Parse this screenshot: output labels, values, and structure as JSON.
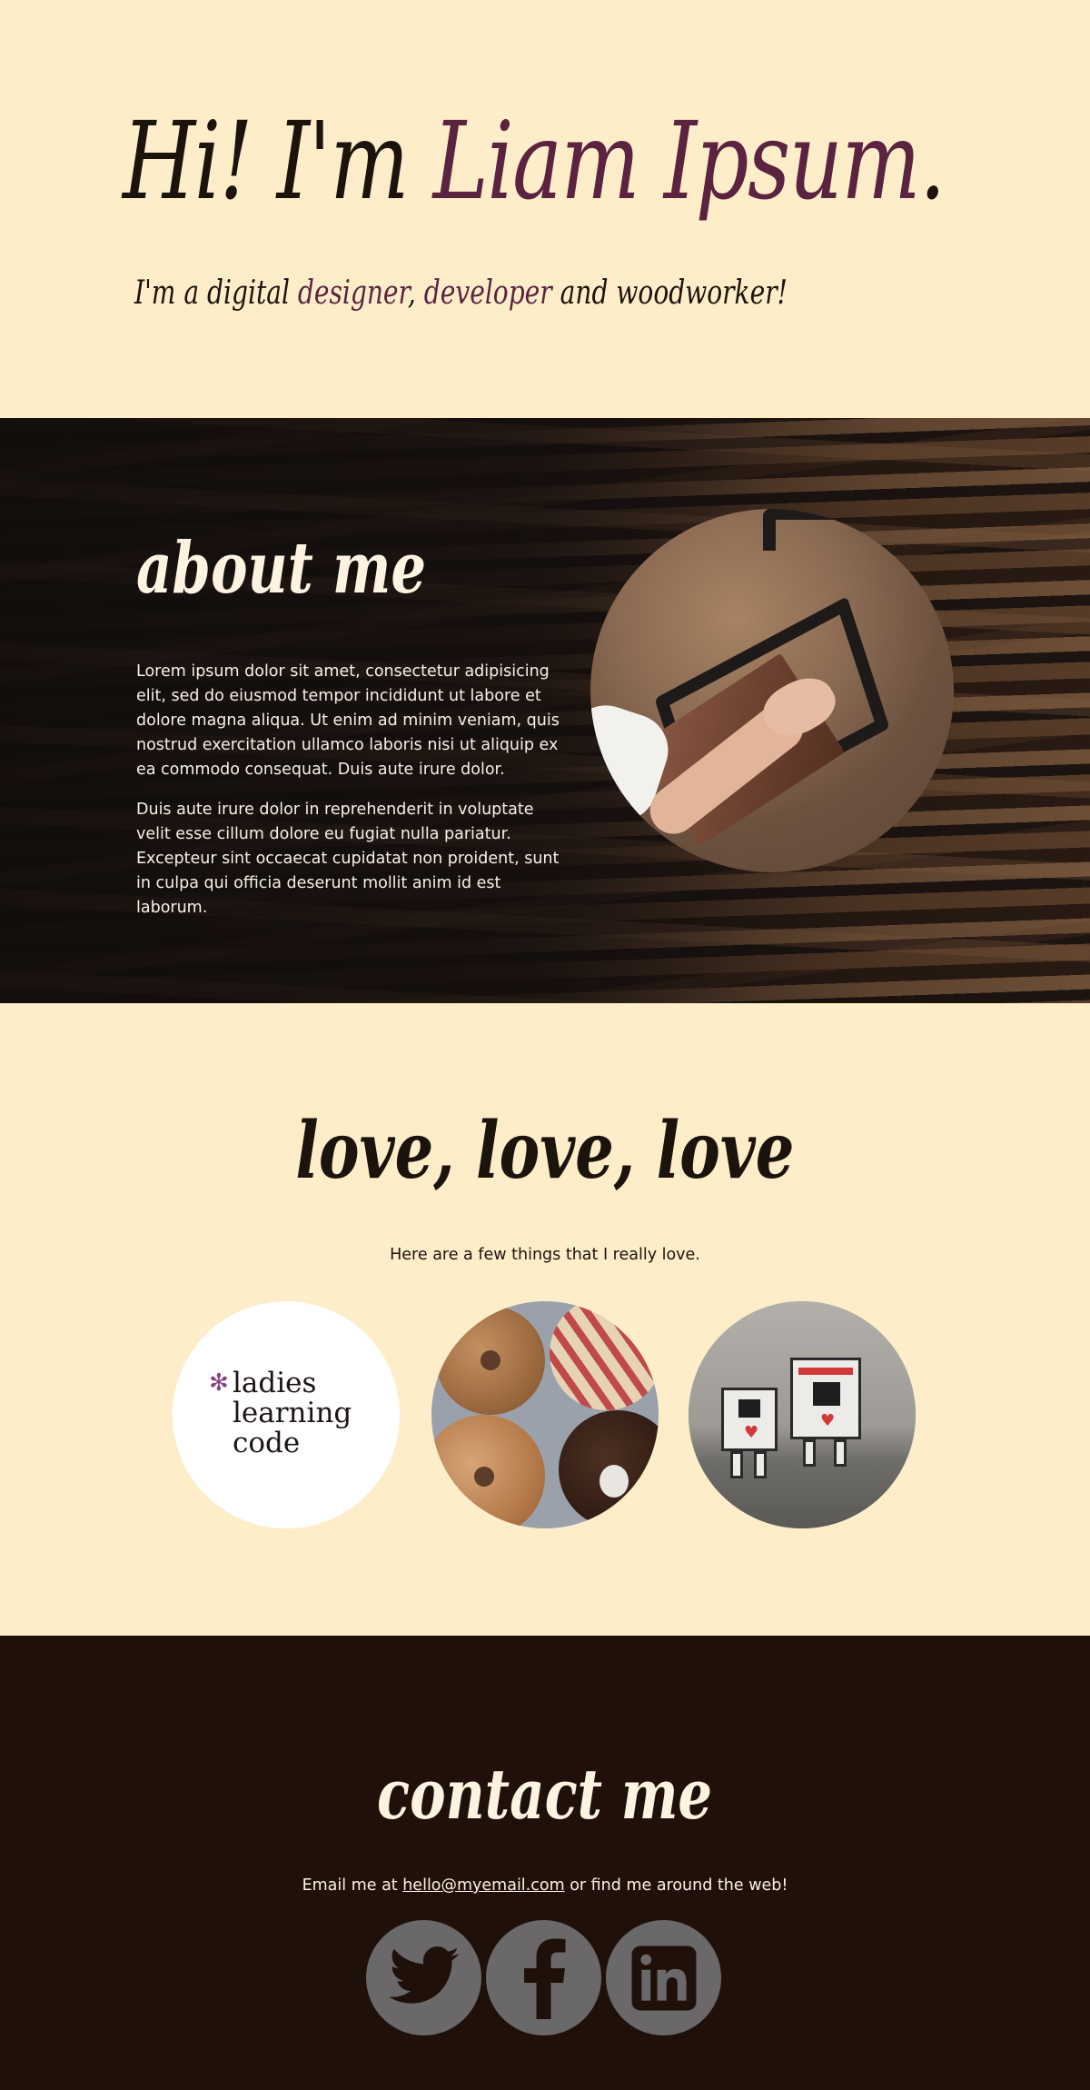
{
  "hero": {
    "title_prefix": "Hi! I'm ",
    "title_name": "Liam Ipsum",
    "title_suffix": ".",
    "sub_prefix": "I'm a digital ",
    "sub_role1": "designer",
    "sub_sep": ", ",
    "sub_role2": "developer",
    "sub_suffix": " and woodworker!"
  },
  "about": {
    "heading": "about me",
    "paragraphs": [
      "Lorem ipsum dolor sit amet, consectetur adipisicing elit, sed do eiusmod tempor incididunt ut labore et dolore magna aliqua. Ut enim ad minim veniam, quis nostrud exercitation ullamco laboris nisi ut aliquip ex ea commodo consequat. Duis aute irure dolor.",
      "Duis aute irure dolor in reprehenderit in voluptate velit esse cillum dolore eu fugiat nulla pariatur. Excepteur sint occaecat cupidatat non proident, sunt in culpa qui officia deserunt mollit anim id est laborum."
    ]
  },
  "love": {
    "heading": "love, love, love",
    "subtitle": "Here are a few things that I really love.",
    "logo_lines": [
      "ladies",
      "learning",
      "code"
    ],
    "logo_mark": "✻"
  },
  "contact": {
    "heading": "contact me",
    "line_prefix": "Email me at ",
    "email": "hello@myemail.com",
    "line_suffix": " or find me around the web!",
    "icons": [
      "twitter-icon",
      "facebook-icon",
      "linkedin-icon"
    ]
  },
  "colors": {
    "background": "#fdeec9",
    "accent": "#5c2340",
    "dark": "#1f1109",
    "social_circle": "#6a6869"
  }
}
